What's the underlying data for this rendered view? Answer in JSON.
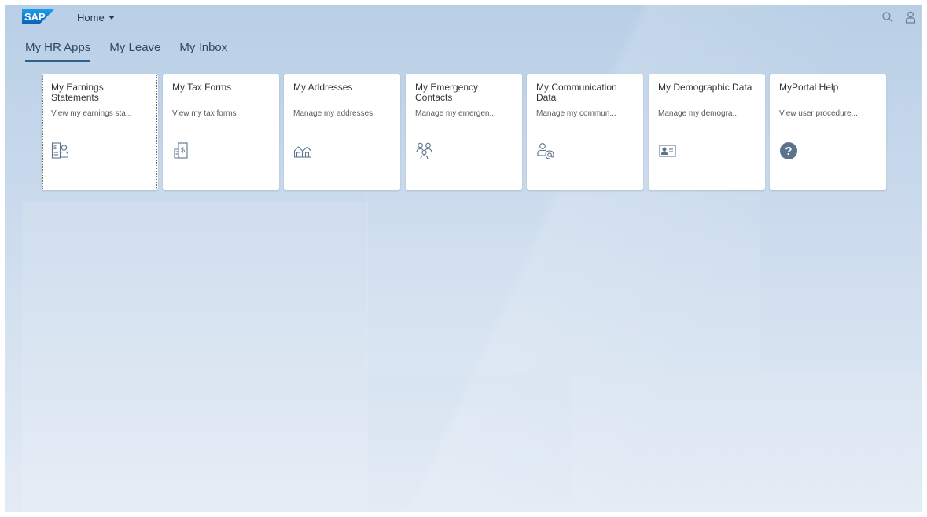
{
  "shell": {
    "logo_text": "SAP",
    "home_label": "Home",
    "icons": [
      "search-icon",
      "user-icon"
    ]
  },
  "tabs": [
    {
      "label": "My HR Apps",
      "active": true
    },
    {
      "label": "My Leave",
      "active": false
    },
    {
      "label": "My Inbox",
      "active": false
    }
  ],
  "tiles": [
    {
      "title": "My Earnings Statements",
      "subtitle": "View my earnings sta...",
      "icon": "earnings-statement-icon"
    },
    {
      "title": "My Tax Forms",
      "subtitle": "View my tax forms",
      "icon": "tax-form-icon"
    },
    {
      "title": "My Addresses",
      "subtitle": "Manage my addresses",
      "icon": "addresses-icon"
    },
    {
      "title": "My Emergency Contacts",
      "subtitle": "Manage my emergen...",
      "icon": "emergency-contacts-icon"
    },
    {
      "title": "My Communication Data",
      "subtitle": "Manage my commun...",
      "icon": "communication-data-icon"
    },
    {
      "title": "My Demographic Data",
      "subtitle": "Manage my demogra...",
      "icon": "demographic-data-icon"
    },
    {
      "title": "MyPortal Help",
      "subtitle": "View user procedure...",
      "icon": "help-icon"
    }
  ],
  "colors": {
    "brand": "#0a6ed1",
    "icon": "#5b738b",
    "help_icon": "#5b738b",
    "tab_underline": "#2e5f91"
  }
}
